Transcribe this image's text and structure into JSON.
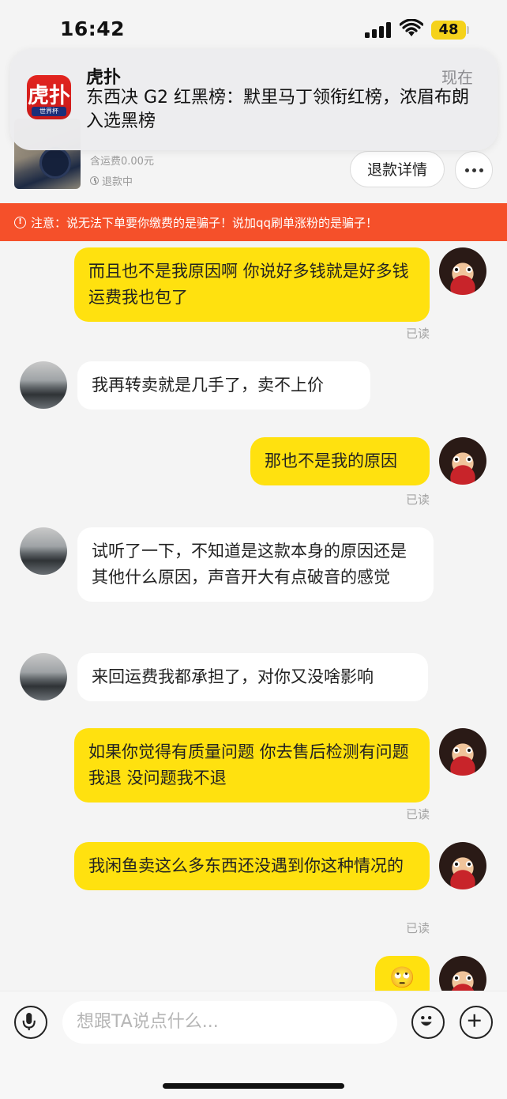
{
  "status_bar": {
    "time": "16:42",
    "battery": "48"
  },
  "notification": {
    "app_name": "虎扑",
    "icon_glyph": "虎扑",
    "icon_sub": "世界杯",
    "time": "现在",
    "body": "东西决 G2 红黑榜：默里马丁领衔红榜，浓眉布朗入选黑榜"
  },
  "order": {
    "shipping": "含运费0.00元",
    "status": "退款中",
    "refund_button": "退款详情"
  },
  "warning": "注意：说无法下单要你缴费的是骗子！说加qq刷单涨粉的是骗子！",
  "messages": [
    {
      "from": "me",
      "text": "而且也不是我原因啊 你说好多钱就是好多钱 运费我也包了",
      "read": "已读"
    },
    {
      "from": "other",
      "text": "我再转卖就是几手了，卖不上价"
    },
    {
      "from": "me",
      "text": "那也不是我的原因",
      "read": "已读"
    },
    {
      "from": "other",
      "text": "试听了一下，不知道是这款本身的原因还是其他什么原因，声音开大有点破音的感觉"
    },
    {
      "from": "other",
      "text": "来回运费我都承担了，对你又没啥影响"
    },
    {
      "from": "me",
      "text": "如果你觉得有质量问题 你去售后检测有问题我退 没问题我不退",
      "read": "已读"
    },
    {
      "from": "me",
      "text": "我闲鱼卖这么多东西还没遇到你这种情况的",
      "read": "已读"
    },
    {
      "from": "me",
      "text": "🙄"
    }
  ],
  "input": {
    "placeholder": "想跟TA说点什么..."
  },
  "icons": {
    "voice": "microphone-icon",
    "emoji": "emoji-icon",
    "plus": "plus-icon"
  }
}
